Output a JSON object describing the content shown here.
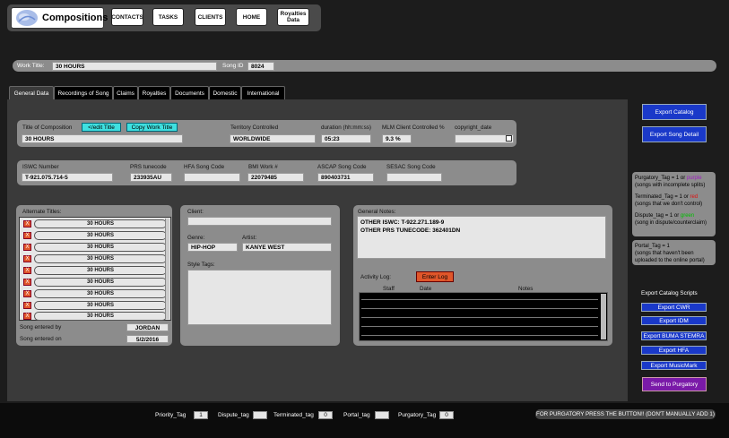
{
  "nav": {
    "app_title": "Compositions",
    "buttons": [
      "CONTACTS",
      "TASKS",
      "CLIENTS",
      "HOME",
      "Royalties Data"
    ]
  },
  "work": {
    "title_label": "Work Title:",
    "title_value": "30 HOURS",
    "song_id_label": "Song ID",
    "song_id_value": "8024"
  },
  "tabs": [
    "General Data",
    "Recordings of Song",
    "Claims",
    "Royalties",
    "Documents",
    "Domestic",
    "International"
  ],
  "general": {
    "title_label": "Title of Composition",
    "edit_title_btn": "</edit Title",
    "copy_title_btn": "Copy Work Title",
    "title_value": "30 HOURS",
    "territory_label": "Territory Controlled",
    "territory_value": "WORLDWIDE",
    "duration_label": "duration (hh:mm:ss)",
    "duration_value": "05:23",
    "mlm_label": "MLM Client Controlled %",
    "mlm_value": "9.3  %",
    "copyright_label": "copyright_date"
  },
  "codes": {
    "iswc_label": "ISWC Number",
    "iswc_value": "T-921.075.714-5",
    "prs_label": "PRS tunecode",
    "prs_value": "233935AU",
    "hfa_label": "HFA Song Code",
    "bmi_label": "BMI Work #",
    "bmi_value": "22079485",
    "ascap_label": "ASCAP Song Code",
    "ascap_value": "890403731",
    "sesac_label": "SESAC Song Code"
  },
  "alt_titles": {
    "label": "Alternate Titles:",
    "items": [
      "30 HOURS",
      "30 HOURS",
      "30 HOURS",
      "30 HOURS",
      "30 HOURS",
      "30 HOURS",
      "30 HOURS",
      "30 HOURS",
      "30 HOURS"
    ],
    "x_label": "X",
    "entered_by_label": "Song entered by",
    "entered_by_value": "JORDAN",
    "entered_on_label": "Song entered on",
    "entered_on_value": "5/2/2016"
  },
  "client": {
    "client_label": "Client:",
    "genre_label": "Genre:",
    "genre_value": "HIP-HOP",
    "artist_label": "Artist:",
    "artist_value": "KANYE WEST",
    "style_label": "Style Tags:"
  },
  "notes": {
    "label": "General Notes:",
    "line1": "OTHER ISWC: T-922.271.189-9",
    "line2": "OTHER PRS TUNECODE: 362401DN",
    "activity_label": "Activity Log:",
    "enter_log_btn": "Enter Log",
    "col_staff": "Staff",
    "col_date": "Date",
    "col_notes": "Notes"
  },
  "right": {
    "export_catalog": "Export Catalog",
    "export_song_detail": "Export Song Detail",
    "purgatory_pre": "Purgatory_Tag = 1 or ",
    "purgatory_color": "purple",
    "purgatory_post": "(songs with incomplete splits)",
    "terminated_pre": "Terminated_Tag = 1 or ",
    "terminated_color": "red",
    "terminated_post": "(songs that we don't control)",
    "dispute_pre": "Dispute_tag = 1 or ",
    "dispute_color": "green",
    "dispute_post": "(song in dispute/counterclaim)",
    "portal_line1": "Portal_Tag = 1",
    "portal_line2": "(songs that haven't been uploaded to the online portal)",
    "scripts_label": "Export Catalog Scripts",
    "scripts": [
      "Export CWR",
      "Export IDM",
      "Export BUMA STEMRA",
      "Export HFA",
      "Export MusicMark"
    ],
    "send_purgatory": "Send to Purgatory",
    "colors": {
      "purple": "#a020c0",
      "red": "#e01010",
      "green": "#00c000"
    }
  },
  "bottom": {
    "priority_label": "Priority_Tag",
    "priority_value": "1",
    "dispute_label": "Dispute_tag",
    "terminated_label": "Terminated_tag",
    "terminated_value": "0",
    "portal_label": "Portal_tag",
    "purgatory_label": "Purgatory_Tag",
    "purgatory_value": "0",
    "warning": "FOR PURGATORY PRESS THE BUTTON!! (DON'T MANUALLY ADD 1)"
  }
}
